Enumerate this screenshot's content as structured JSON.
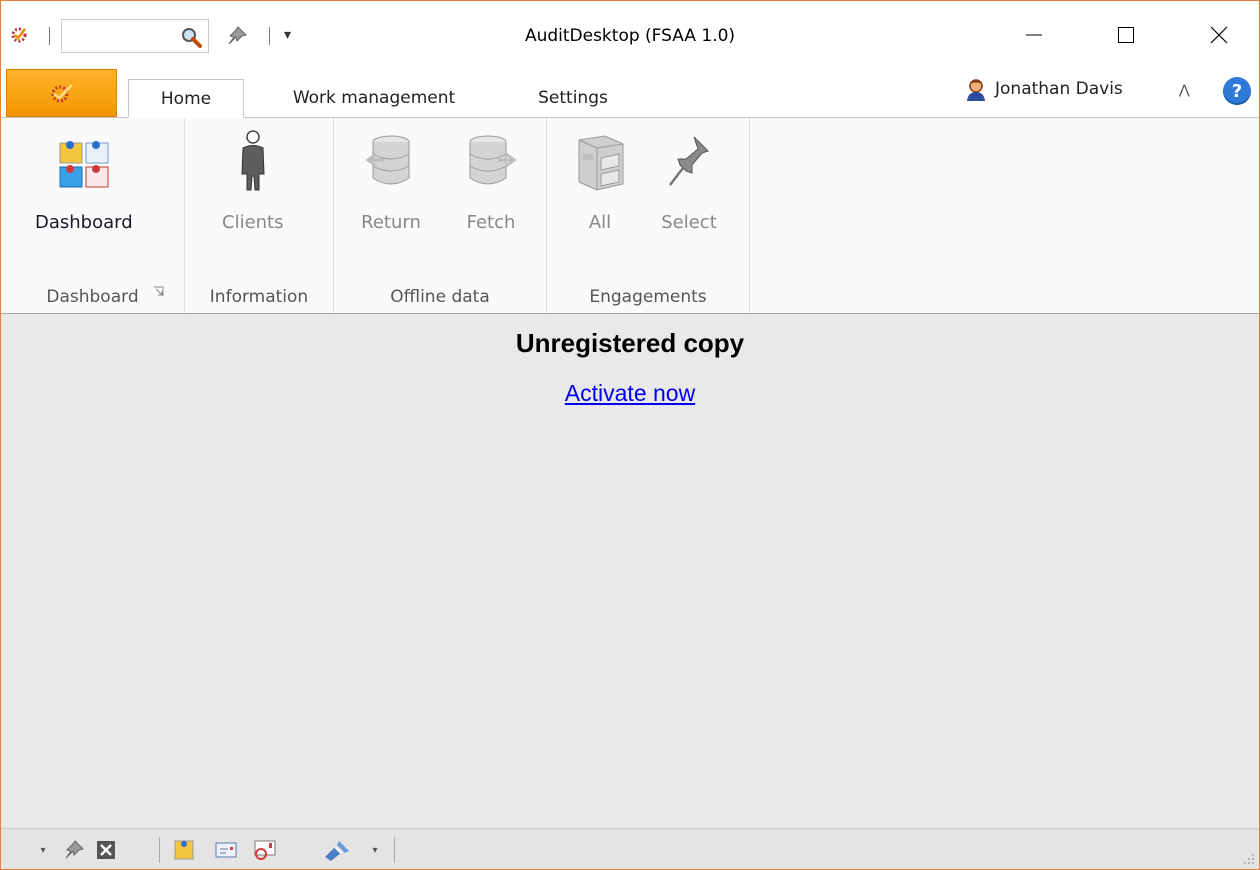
{
  "window": {
    "title": "AuditDesktop (FSAA 1.0)"
  },
  "quick_access": {
    "search_value": "",
    "search_placeholder": "",
    "icons": [
      "app-logo-icon",
      "search-icon",
      "pin-icon",
      "customize-dropdown-icon"
    ]
  },
  "tabs": [
    {
      "label": "Home",
      "active": true
    },
    {
      "label": "Work management",
      "active": false
    },
    {
      "label": "Settings",
      "active": false
    }
  ],
  "user": {
    "name": "Jonathan Davis"
  },
  "ribbon": {
    "groups": [
      {
        "label": "Dashboard",
        "buttons": [
          {
            "label": "Dashboard",
            "enabled": true,
            "icon": "dashboard-icon"
          }
        ]
      },
      {
        "label": "Information",
        "buttons": [
          {
            "label": "Clients",
            "enabled": false,
            "icon": "person-icon"
          }
        ]
      },
      {
        "label": "Offline data",
        "buttons": [
          {
            "label": "Return",
            "enabled": false,
            "icon": "database-return-icon"
          },
          {
            "label": "Fetch",
            "enabled": false,
            "icon": "database-fetch-icon"
          }
        ]
      },
      {
        "label": "Engagements",
        "buttons": [
          {
            "label": "All",
            "enabled": false,
            "icon": "file-cabinet-icon"
          },
          {
            "label": "Select",
            "enabled": false,
            "icon": "pushpin-icon"
          }
        ]
      }
    ]
  },
  "content": {
    "heading": "Unregistered copy",
    "link": "Activate now"
  },
  "colors": {
    "window_border": "#e8823a",
    "app_button": "#f29600",
    "link": "#0000ee",
    "help": "#2e7ad6"
  },
  "statusbar": {
    "icons": [
      "dropdown-icon",
      "pin-icon",
      "close-box-icon",
      "note-icon",
      "message-icon",
      "sticky-note-icon",
      "satellite-icon",
      "dropdown-icon"
    ]
  }
}
